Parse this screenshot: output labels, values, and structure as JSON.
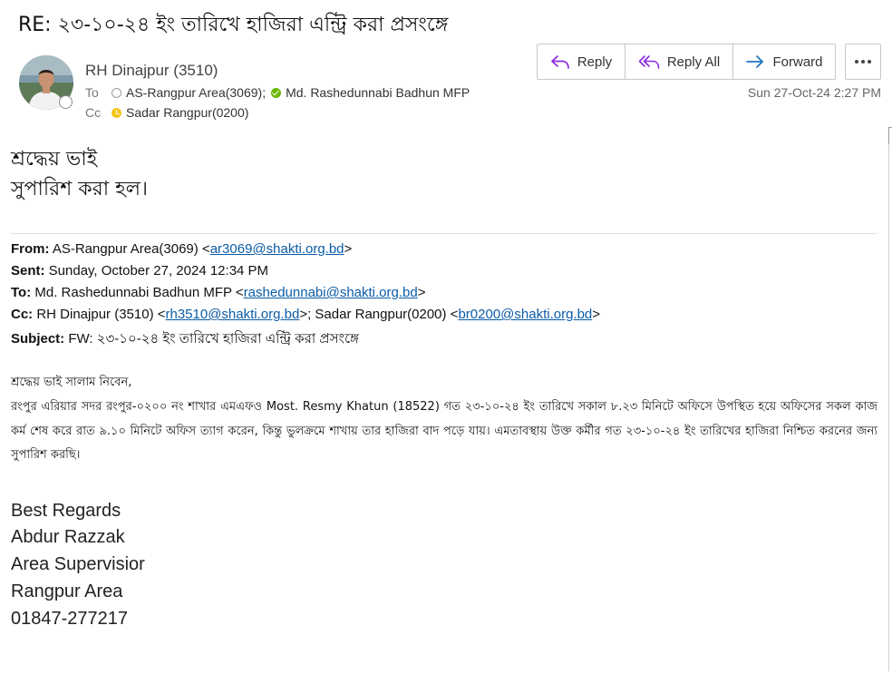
{
  "message": {
    "subject": "RE: ২৩-১০-২৪ ইং তারিখে হাজিরা এন্ট্রি করা প্রসংঙ্গে",
    "sender": "RH Dinajpur (3510)",
    "to_label": "To",
    "cc_label": "Cc",
    "to": [
      {
        "name": "AS-Rangpur Area(3069);",
        "status": "unknown"
      },
      {
        "name": "Md. Rashedunnabi Badhun MFP",
        "status": "available"
      }
    ],
    "cc": [
      {
        "name": "Sadar Rangpur(0200)",
        "status": "away"
      }
    ],
    "date": "Sun 27-Oct-24 2:27 PM",
    "colors": {
      "available": "#6bb700",
      "away": "#f5c518",
      "accent": "#8a2be2",
      "link": "#0b5ca8"
    }
  },
  "actions": {
    "reply": {
      "label": "Reply",
      "icon": "reply-icon"
    },
    "reply_all": {
      "label": "Reply All",
      "icon": "reply-all-icon"
    },
    "forward": {
      "label": "Forward",
      "icon": "forward-arrow-icon"
    },
    "more": {
      "icon": "more-options-icon"
    }
  },
  "reply_body": {
    "line1": "শ্রদ্ধেয় ভাই",
    "line2": "সুপারিশ করা হল।"
  },
  "quoted": {
    "from_label": "From:",
    "from_name": " AS-Rangpur Area(3069) <",
    "from_email": "ar3069@shakti.org.bd",
    "close": ">",
    "sent_label": "Sent:",
    "sent_value": " Sunday, October 27, 2024 12:34 PM",
    "to_label": "To:",
    "to_name": " Md. Rashedunnabi Badhun MFP <",
    "to_email": "rashedunnabi@shakti.org.bd",
    "cc_label": "Cc:",
    "cc_name1": " RH Dinajpur (3510) <",
    "cc_email1": "rh3510@shakti.org.bd",
    "cc_mid": ">; Sadar Rangpur(0200) <",
    "cc_email2": "br0200@shakti.org.bd",
    "subject_label": "Subject:",
    "subject_value": " FW: ২৩-১০-২৪ ইং তারিখে হাজিরা এন্ট্রি করা প্রসংঙ্গে",
    "greeting": "শ্রদ্ধেয় ভাই সালাম নিবেন,",
    "paragraph": "রংপুর এরিয়ার সদর রংপুর-০২০০ নং শাখার এমএফও Most. Resmy Khatun (18522) গত ২৩-১০-২৪ ইং তারিখে সকাল ৮.২৩ মিনিটে অফিসে উপস্থিত হয়ে অফিসের সকল কাজ কর্ম শেষ করে রাত ৯.১০ মিনিটে অফিস ত্যাগ করেন, কিন্তু ভুলক্রমে শাখায় তার হাজিরা বাদ পড়ে যায়। এমতাবস্থায় উক্ত কর্মীর গত ২৩-১০-২৪ ইং তারিখের হাজিরা নিশ্চিত করনের জন্য সুপারিশ করছি।"
  },
  "signature": {
    "line1": "Best Regards",
    "line2": "Abdur Razzak",
    "line3": "Area Supervisior",
    "line4": "Rangpur Area",
    "line5": "01847-277217"
  }
}
